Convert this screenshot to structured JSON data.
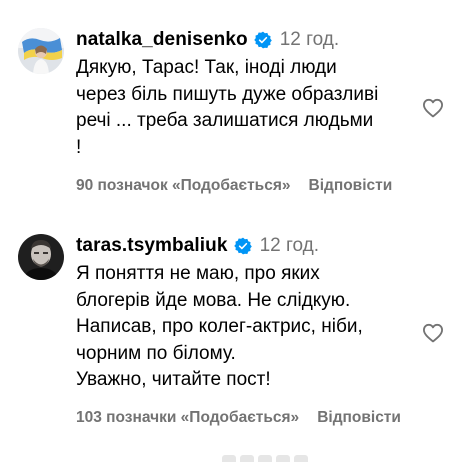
{
  "comments": [
    {
      "username": "natalka_denisenko",
      "time": "12 год.",
      "lines": [
        "Дякую, Тарас! Так, іноді люди",
        "через біль пишуть дуже образливі",
        "речі ... треба залишатися людьми",
        "!"
      ],
      "likes": "90 позначок «Подобається»",
      "reply": "Відповісти",
      "avatar_icon": "avatar-woman-with-ukrainian-flag",
      "verified_icon": "verified-badge-icon",
      "like_icon": "heart-outline-icon"
    },
    {
      "username": "taras.tsymbaliuk",
      "time": "12 год.",
      "lines": [
        "Я поняття не маю, про яких",
        "блогерів йде мова. Не слідкую.",
        "Написав, про колег-актрис, ніби,",
        "чорним по білому.",
        "Уважно, читайте пост!"
      ],
      "likes": "103 позначки «Подобається»",
      "reply": "Відповісти",
      "avatar_icon": "avatar-man-dark-background",
      "verified_icon": "verified-badge-icon",
      "like_icon": "heart-outline-icon"
    }
  ],
  "colors": {
    "text": "#000000",
    "secondary": "#737373",
    "verified": "#0095f6"
  }
}
